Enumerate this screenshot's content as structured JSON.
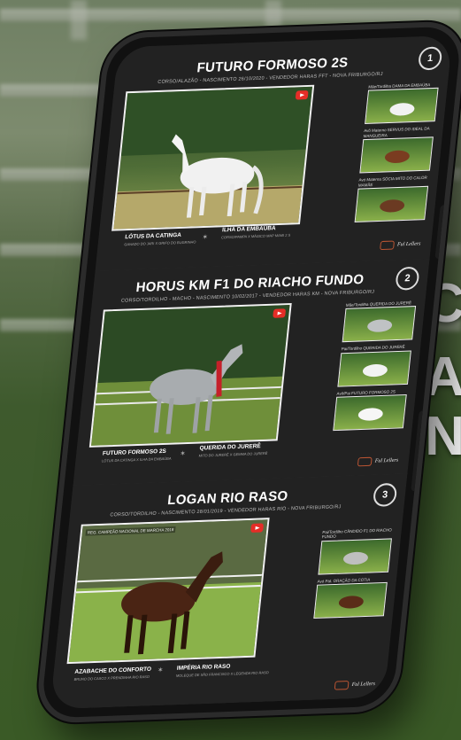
{
  "side_text": [
    "C",
    "A",
    "N"
  ],
  "cards": [
    {
      "number": "1",
      "title": "FUTURO FORMOSO 2S",
      "subtitle": "CORSO/ALAZÃO - NASCIMENTO 26/10/2020 - VENDEDOR HARAS FFT - NOVA FRIBURGO/RJ",
      "sire": "LÓTUS DA CATINGA",
      "sire_sub": "GANADO DO JARI X GRIFO DO BUGRINHO",
      "dam": "ILHA DA EMBAÚBA",
      "dam_sub": "CORSO/PAMPA X MÁGICO MAP MAMI 2 S",
      "thumbs": [
        {
          "label": "Mãe/Tordilha DAMA DA EMBAÚBA"
        },
        {
          "label": "Avô Materno SERVUS DO IDEAL DA MANGUEIRA"
        },
        {
          "label": "Avó Materna SÓCIA MITO DO CALOR MAMÃE"
        }
      ]
    },
    {
      "number": "2",
      "title": "HORUS KM F1 DO RIACHO FUNDO",
      "subtitle": "CORSO/TORDILHO - MACHO - NASCIMENTO 10/02/2017 - VENDEDOR HARAS KM - NOVA FRIBURGO/RJ",
      "sire": "FUTURO FORMOSO 2S",
      "sire_sub": "LÓTUS DA CATINGA X ILHA DA EMBAÚBA",
      "dam": "QUERIDA DO JURERÊ",
      "dam_sub": "MITO DO JURERÊ X GEMMA DO JURERÊ",
      "thumbs": [
        {
          "label": "Mãe/Tordilha QUERIDA DO JURERÊ"
        },
        {
          "label": "Pai/Tordilho QUERIDA DO JURERÊ"
        },
        {
          "label": "Avô/Pai FUTURO FORMOSO 2S"
        }
      ]
    },
    {
      "number": "3",
      "title": "LOGAN RIO RASO",
      "subtitle": "CORSO/TORDILHO - NASCIMENTO 28/01/2019 - VENDEDOR HARAS RIO - NOVA FRIBURGO/RJ",
      "award": "REG. CAMPEÃO NACIONAL DE MARCHA 2018",
      "sire": "AZABACHE DO CONFORTO",
      "sire_sub": "BRUNO DO CASCO X PRENDINHA RIO RASO",
      "dam": "IMPÉRIA RIO RASO",
      "dam_sub": "MOLEQUE DE SÃO FRANCISCO X LEGENDA RIO RASO",
      "thumbs": [
        {
          "label": "Pai/Tordilho CÂNDIDO F1 DO RIACHO FUNDO"
        },
        {
          "label": "Avó Pat. ORAÇÃO DA COTIA"
        }
      ]
    }
  ],
  "logos": {
    "brand": "Ful Lellers"
  },
  "icons": {
    "youtube": "youtube-icon",
    "star": "star-icon"
  }
}
